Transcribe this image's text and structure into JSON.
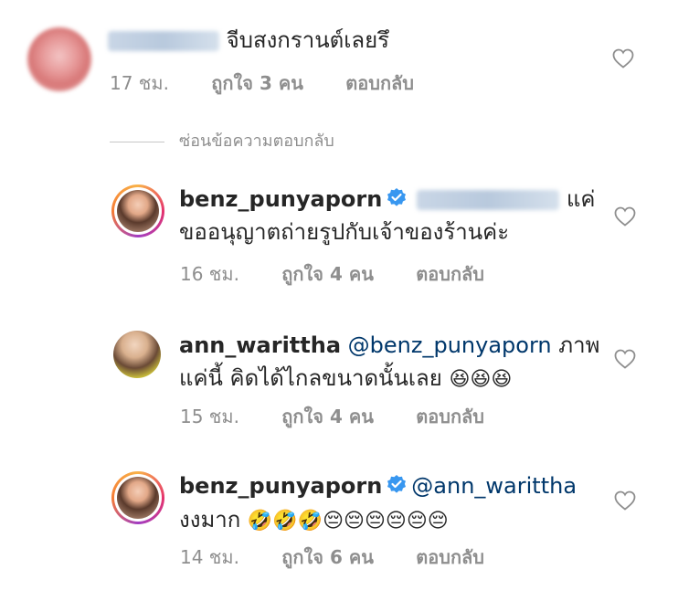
{
  "comments": [
    {
      "username": "",
      "text": "จีบสงกรานต์เลยรึ",
      "time": "17 ชม.",
      "likes": "ถูกใจ 3 คน",
      "reply": "ตอบกลับ",
      "avatar": "blurred-avatar"
    },
    {
      "username": "benz_punyaporn",
      "verified": true,
      "line1_text": "แค่",
      "line2_text": "ขออนุญาตถ่ายรูปกับเจ้าของร้านค่ะ",
      "time": "16 ชม.",
      "likes": "ถูกใจ 4 คน",
      "reply": "ตอบกลับ"
    },
    {
      "username": "ann_warittha",
      "mention": "@benz_punyaporn",
      "line1_text": "ภาพ",
      "line2_text": "แค่นี้ คิดได้ไกลขนาดนั้นเลย",
      "emojis": "😆😆😆",
      "time": "15 ชม.",
      "likes": "ถูกใจ 4 คน",
      "reply": "ตอบกลับ"
    },
    {
      "username": "benz_punyaporn",
      "verified": true,
      "mention": "@ann_warittha",
      "line2_text": "งงมาก",
      "emojis": "🤣🤣🤣😔😔😔😔😔😔",
      "time": "14 ชม.",
      "likes": "ถูกใจ 6 คน",
      "reply": "ตอบกลับ"
    }
  ],
  "hide_replies": "ซ่อนข้อความตอบกลับ",
  "colors": {
    "text": "#262626",
    "muted": "#8e8e8e",
    "mention": "#00376b",
    "verified": "#3897f0"
  },
  "icons": {
    "like": "heart-outline-icon",
    "verified": "verified-badge-icon"
  }
}
